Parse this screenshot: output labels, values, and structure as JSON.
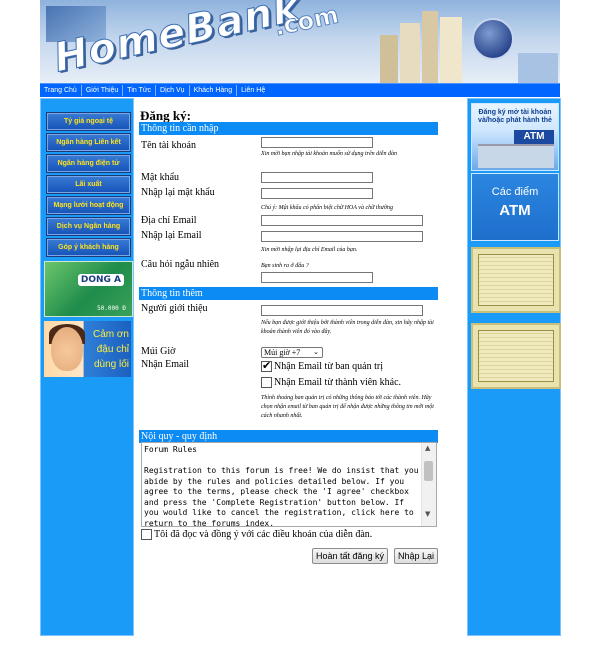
{
  "site": {
    "logo_text": "HomeBank",
    "logo_suffix": ".com"
  },
  "nav": {
    "items": [
      "Trang Chủ",
      "Giới Thiệu",
      "Tin Tức",
      "Dịch Vụ",
      "Khách Hàng",
      "Liên Hệ"
    ]
  },
  "left_menu": {
    "items": [
      "Tỷ giá ngoại tệ",
      "Ngân hàng Liên kết",
      "Ngân hàng điện tử",
      "Lãi xuất",
      "Mạng lưới hoạt động",
      "Dịch vụ Ngân hàng",
      "Góp ý khách hàng"
    ]
  },
  "left_ads": {
    "card": {
      "brand": "DONG A",
      "amount": "50.000 Đ"
    },
    "kid": {
      "text": "Cảm ơn đậu chỉ dùng lối"
    }
  },
  "right_ads": {
    "atm_register": {
      "text": "Đăng ký mở tài khoản và/hoặc phát hành thẻ",
      "badge": "ATM"
    },
    "atm_points": {
      "line1": "Các điểm",
      "line2": "ATM"
    }
  },
  "form": {
    "title": "Đăng ký:",
    "section_required": "Thông tin cần nhập",
    "username_label": "Tên tài khoản",
    "username_note": "Xin mời bạn nhập tài khoản muốn sử dụng trên diễn đàn",
    "password_label": "Mật khẩu",
    "password_confirm_label": "Nhập lại mật khẩu",
    "password_note": "Chú ý: Mật khẩu có phân biệt chữ HOA và chữ thường",
    "email_label": "Địa chỉ Email",
    "email_confirm_label": "Nhập lại Email",
    "email_note": "Xin mời nhập lại địa chỉ Email của bạn.",
    "random_question_label": "Câu hỏi ngẫu nhiên",
    "random_question_text": "Bạn sinh ra ở đâu ?",
    "section_extra": "Thông tin thêm",
    "referrer_label": "Người giới thiệu",
    "referrer_note": "Nếu bạn được giới thiệu bởi thành viên trong diễn đàn, xin hãy nhập tài khoản thành viên đó vào đây.",
    "timezone_label": "Múi Giờ",
    "timezone_value": "Múi giờ +7",
    "receive_email_label": "Nhận Email",
    "receive_admin_label": "Nhận Email từ ban quản trị",
    "receive_admin_checked": true,
    "receive_members_label": "Nhận Email từ thành viên khác.",
    "receive_members_checked": false,
    "receive_note": "Thỉnh thoảng ban quản trị có những thông báo tới các thành viên. Hãy chọn nhận email từ ban quản trị để nhận được những thông tin mới một cách nhanh nhất.",
    "section_rules": "Nội quy - quy định",
    "rules_text": "Forum Rules\n\nRegistration to this forum is free! We do insist that you abide by the rules and policies detailed below. If you agree to the terms, please check the 'I agree' checkbox and press the 'Complete Registration' button below. If you would like to cancel the registration, click here to return to the forums index.",
    "agree_label": "Tôi đã đọc và đồng ý với các điều khoản của diễn đàn.",
    "agree_checked": false,
    "submit_label": "Hoàn tất đăng ký",
    "reset_label": "Nhập Lại"
  },
  "colors": {
    "nav_bg": "#0066ff",
    "side_bg": "#199bf7",
    "section_bg": "#0d8bf4",
    "menu_text": "#ffe21a"
  }
}
